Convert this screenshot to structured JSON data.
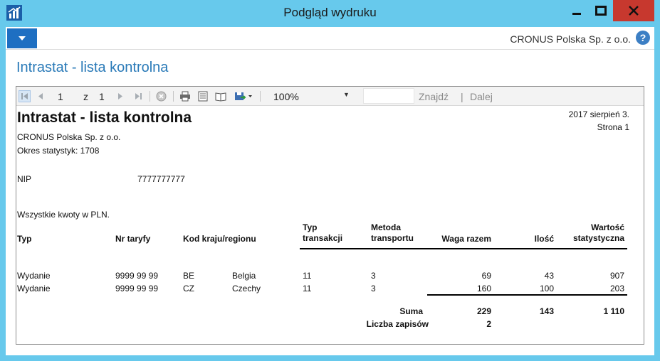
{
  "window": {
    "title": "Podgląd wydruku",
    "company": "CRONUS Polska Sp. z o.o.",
    "help_label": "?"
  },
  "page": {
    "title": "Intrastat - lista kontrolna"
  },
  "toolbar": {
    "page_current": "1",
    "page_of_label": "z",
    "page_total": "1",
    "zoom": "100%",
    "find_label": "Znajdź",
    "next_label": "Dalej",
    "separator": "|"
  },
  "report": {
    "title": "Intrastat - lista kontrolna",
    "date": "2017 sierpień 3.",
    "page_label": "Strona 1",
    "company": "CRONUS Polska Sp. z o.o.",
    "period": "Okres statystyk: 1708",
    "nip_label": "NIP",
    "nip_value": "7777777777",
    "currency_note": "Wszystkie kwoty w PLN.",
    "columns": {
      "typ": "Typ",
      "nr_taryfy": "Nr taryfy",
      "kod_kraju": "Kod kraju/regionu",
      "typ_transakcji_1": "Typ",
      "typ_transakcji_2": "transakcji",
      "metoda_1": "Metoda",
      "metoda_2": "transportu",
      "waga": "Waga razem",
      "ilosc": "Ilość",
      "wartosc_1": "Wartość",
      "wartosc_2": "statystyczna"
    },
    "rows": [
      {
        "typ": "Wydanie",
        "nr_taryfy": "9999 99 99",
        "kod": "BE",
        "kraj": "Belgia",
        "transakcja": "11",
        "transport": "3",
        "waga": "69",
        "ilosc": "43",
        "wartosc": "907"
      },
      {
        "typ": "Wydanie",
        "nr_taryfy": "9999 99 99",
        "kod": "CZ",
        "kraj": "Czechy",
        "transakcja": "11",
        "transport": "3",
        "waga": "160",
        "ilosc": "100",
        "wartosc": "203"
      }
    ],
    "totals": {
      "suma_label": "Suma",
      "waga": "229",
      "ilosc": "143",
      "wartosc": "1 110",
      "count_label": "Liczba zapisów",
      "count": "2"
    }
  },
  "colors": {
    "titlebar": "#67c9ec",
    "accent_blue": "#1e6fc2",
    "title_blue": "#2a7ab8",
    "close_red": "#c7382e"
  },
  "icons": [
    "app-icon",
    "minimize-icon",
    "maximize-icon",
    "close-icon",
    "dropdown-menu-icon",
    "help-icon",
    "first-page-icon",
    "previous-page-icon",
    "next-page-icon",
    "last-page-icon",
    "stop-icon",
    "print-icon",
    "page-layout-icon",
    "page-setup-icon",
    "export-icon",
    "zoom-dropdown-icon"
  ]
}
